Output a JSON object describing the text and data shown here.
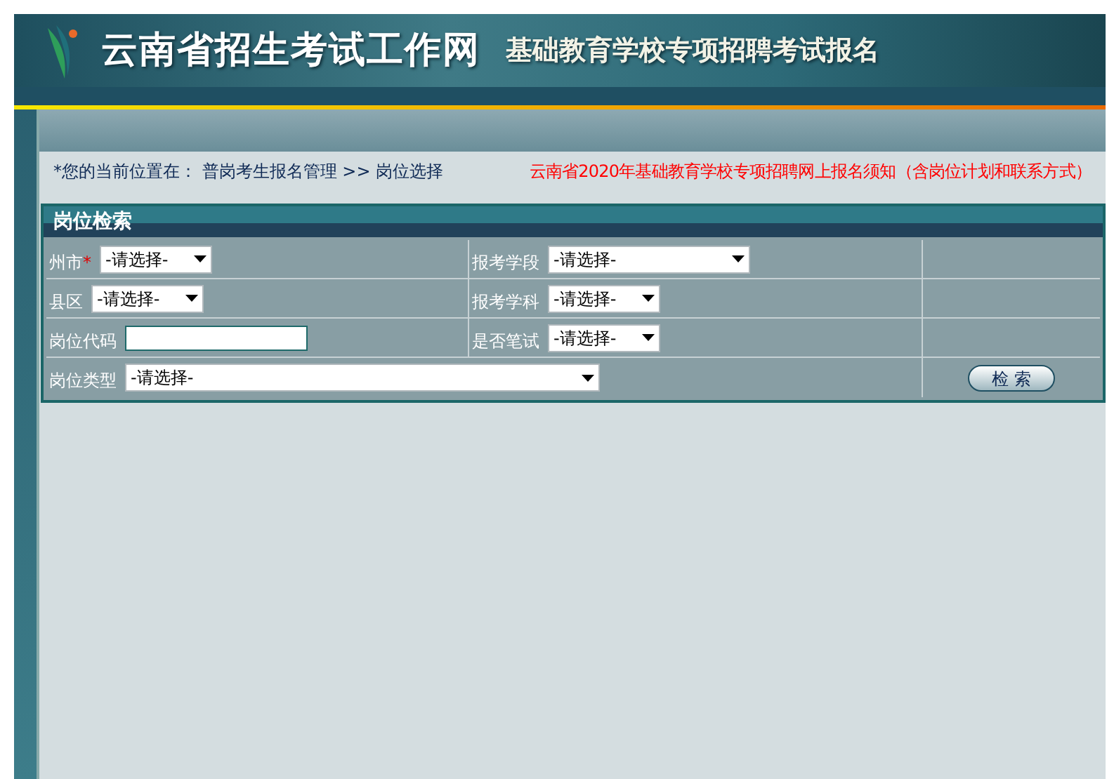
{
  "header": {
    "site_title": "云南省招生考试工作网",
    "subtitle": "基础教育学校专项招聘考试报名"
  },
  "breadcrumb": {
    "prefix": "*您的当前位置在：",
    "path": "普岗考生报名管理",
    "separator": ">>",
    "current": "岗位选择"
  },
  "notice_link": "云南省2020年基础教育学校专项招聘网上报名须知（含岗位计划和联系方式）",
  "search_panel": {
    "title": "岗位检索",
    "rows": [
      [
        {
          "label": "州市",
          "required": true,
          "kind": "select",
          "value": "-请选择-"
        },
        {
          "label": "报考学段",
          "required": false,
          "kind": "select",
          "value": "-请选择-"
        }
      ],
      [
        {
          "label": "县区",
          "required": false,
          "kind": "select",
          "value": "-请选择-"
        },
        {
          "label": "报考学科",
          "required": false,
          "kind": "select",
          "value": "-请选择-"
        }
      ],
      [
        {
          "label": "岗位代码",
          "required": false,
          "kind": "text"
        },
        {
          "label": "是否笔试",
          "required": false,
          "kind": "select",
          "value": "-请选择-"
        }
      ],
      [
        {
          "label": "岗位类型",
          "required": false,
          "kind": "select",
          "value": "-请选择-"
        }
      ]
    ],
    "required_mark": "*",
    "search_button": "检 索"
  }
}
